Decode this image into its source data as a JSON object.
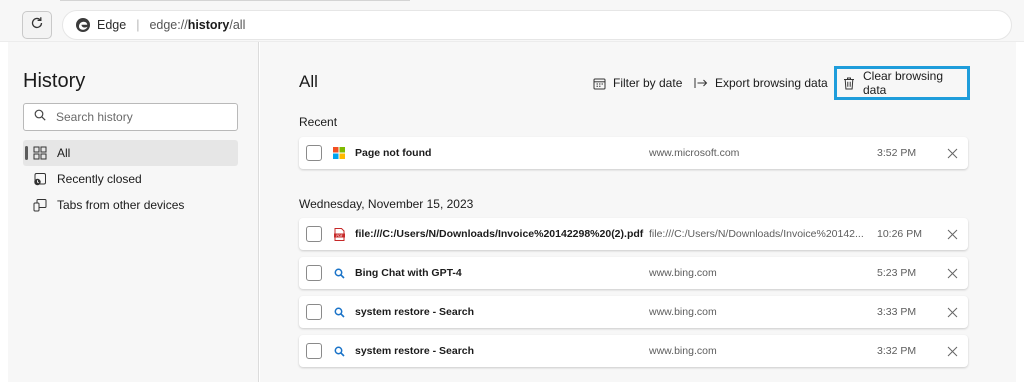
{
  "address_bar": {
    "browser_name": "Edge",
    "url_prefix": "edge://",
    "url_bold": "history",
    "url_suffix": "/all"
  },
  "sidebar": {
    "title": "History",
    "search_placeholder": "Search history",
    "items": [
      {
        "label": "All",
        "icon": "grid-icon",
        "active": true
      },
      {
        "label": "Recently closed",
        "icon": "recently-closed-icon",
        "active": false
      },
      {
        "label": "Tabs from other devices",
        "icon": "devices-icon",
        "active": false
      }
    ]
  },
  "main": {
    "title": "All",
    "filter_label": "Filter by date",
    "export_label": "Export browsing data",
    "clear_label": "Clear browsing data",
    "highlight_color": "#1f9ddb",
    "sections": [
      {
        "label": "Recent",
        "rows": [
          {
            "title": "Page not found",
            "domain": "www.microsoft.com",
            "time": "3:52 PM",
            "favicon": "microsoft-logo-icon"
          }
        ]
      },
      {
        "label": "Wednesday, November 15, 2023",
        "rows": [
          {
            "title": "file:///C:/Users/N/Downloads/Invoice%20142298%20(2).pdf",
            "domain": "file:///C:/Users/N/Downloads/Invoice%20142...",
            "time": "10:26 PM",
            "favicon": "pdf-icon"
          },
          {
            "title": "Bing Chat with GPT-4",
            "domain": "www.bing.com",
            "time": "5:23 PM",
            "favicon": "bing-search-icon"
          },
          {
            "title": "system restore - Search",
            "domain": "www.bing.com",
            "time": "3:33 PM",
            "favicon": "bing-search-icon"
          },
          {
            "title": "system restore - Search",
            "domain": "www.bing.com",
            "time": "3:32 PM",
            "favicon": "bing-search-icon"
          }
        ]
      }
    ]
  }
}
